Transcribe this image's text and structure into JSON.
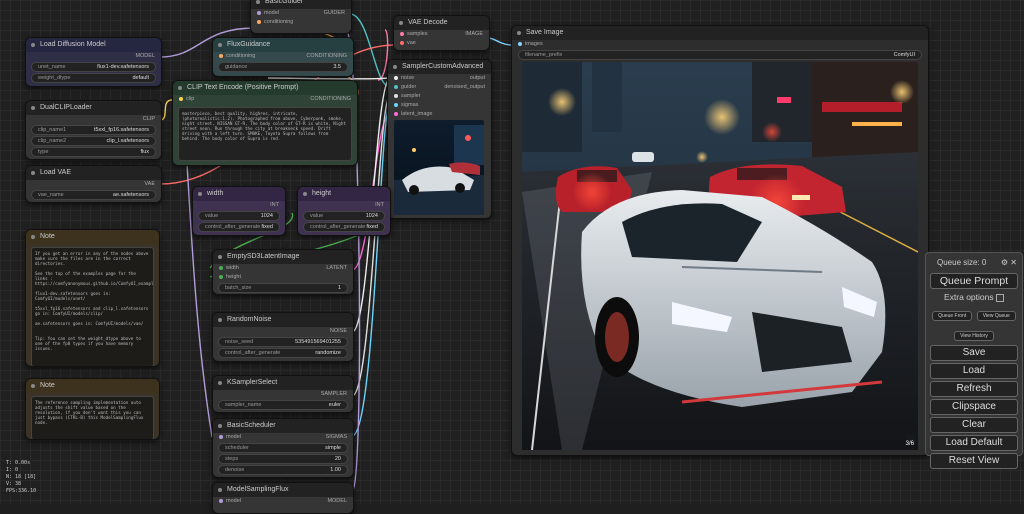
{
  "nodes": {
    "basic_guider": {
      "title": "BasicGuider",
      "model": "model",
      "conditioning": "conditioning",
      "out": "GUIDER"
    },
    "vae_decode": {
      "title": "VAE Decode",
      "samples": "samples",
      "vae": "vae",
      "out": "IMAGE"
    },
    "save_image": {
      "title": "Save Image",
      "images": "images",
      "prefix_label": "filename_prefix",
      "prefix_value": "ComfyUI",
      "counter": "3/6"
    },
    "load_diffusion": {
      "title": "Load Diffusion Model",
      "out": "MODEL",
      "unet_label": "unet_name",
      "unet_value": "flux1-dev.safetensors",
      "dtype_label": "weight_dtype",
      "dtype_value": "default"
    },
    "flux_guidance": {
      "title": "FluxGuidance",
      "in": "conditioning",
      "out": "CONDITIONING",
      "g_label": "guidance",
      "g_value": "3.5"
    },
    "sampler_adv": {
      "title": "SamplerCustomAdvanced",
      "inputs": [
        "noise",
        "guider",
        "sampler",
        "sigmas",
        "latent_image"
      ],
      "outputs": [
        "output",
        "denoised_output"
      ]
    },
    "clip_text": {
      "title": "CLIP Text Encode (Positive Prompt)",
      "in": "clip",
      "out": "CONDITIONING",
      "text": "masterpiece, best quality, highres, intricate, (photorealistic:1.2), Photographed from above, Cyberpunk, smoke, night street, NISSAN GT-R, The body color of GT-R is white, Night street neon. Run through the city at breakneck speed. Drift driving with a left turn. SMOKE, Toyota Supra follows from behind. The body color of Supra is red."
    },
    "dual_clip": {
      "title": "DualCLIPLoader",
      "out": "CLIP",
      "c1_label": "clip_name1",
      "c1_value": "t5xxl_fp16.safetensors",
      "c2_label": "clip_name2",
      "c2_value": "clip_l.safetensors",
      "type_label": "type",
      "type_value": "flux"
    },
    "load_vae": {
      "title": "Load VAE",
      "out": "VAE",
      "label": "vae_name",
      "value": "ae.safetensors"
    },
    "width": {
      "title": "width",
      "out": "INT",
      "label": "value",
      "value": "1024",
      "cag_label": "control_after_generate",
      "cag_value": "fixed"
    },
    "height": {
      "title": "height",
      "out": "INT",
      "label": "value",
      "value": "1024",
      "cag_label": "control_after_generate",
      "cag_value": "fixed"
    },
    "note1": {
      "title": "Note",
      "text": "If you get an error in any of the nodes above make sure the files are in the correct directories.\n\nSee the top of the examples page for the links : https://comfyanonymous.github.io/ComfyUI_examples/flux/\n\nflux1-dev.safetensors goes in: ComfyUI/models/unet/\n\nt5xxl_fp16.safetensors and clip_l.safetensors go in: ComfyUI/models/clip/\n\nae.safetensors goes in: ComfyUI/models/vae/\n\n\nTip: You can set the weight_dtype above to one of the fp8 types if you have memory issues."
    },
    "note2": {
      "title": "Note",
      "text": "The reference sampling implementation auto adjusts the shift value based on the resolution, if you don't want this you can just bypass (CTRL-B) this ModelSamplingFlux node."
    },
    "empty_latent": {
      "title": "EmptySD3LatentImage",
      "in1": "width",
      "in2": "height",
      "out": "LATENT",
      "label": "batch_size",
      "value": "1"
    },
    "random_noise": {
      "title": "RandomNoise",
      "out": "NOISE",
      "seed_label": "noise_seed",
      "seed_value": "535491569401255",
      "cag_label": "control_after_generate",
      "cag_value": "randomize"
    },
    "ksampler_select": {
      "title": "KSamplerSelect",
      "out": "SAMPLER",
      "label": "sampler_name",
      "value": "euler"
    },
    "basic_scheduler": {
      "title": "BasicScheduler",
      "in": "model",
      "out": "SIGMAS",
      "sch_label": "scheduler",
      "sch_value": "simple",
      "steps_label": "steps",
      "steps_value": "20",
      "den_label": "denoise",
      "den_value": "1.00"
    },
    "model_sampling": {
      "title": "ModelSamplingFlux",
      "in": "model",
      "out": "MODEL"
    }
  },
  "queue": {
    "size_label": "Queue size: 0",
    "queue_prompt": "Queue Prompt",
    "extra_options": "Extra options",
    "queue_front": "Queue Front",
    "view_queue": "View Queue",
    "view_history": "View History",
    "save": "Save",
    "load": "Load",
    "refresh": "Refresh",
    "clipspace": "Clipspace",
    "clear": "Clear",
    "load_default": "Load Default",
    "reset_view": "Reset View"
  },
  "stats": [
    "T: 0.00s",
    "I: 0",
    "N: 18 [18]",
    "V: 38",
    "FPS:336.10"
  ],
  "icons": {
    "settings": "gear-icon",
    "close": "close-icon"
  }
}
